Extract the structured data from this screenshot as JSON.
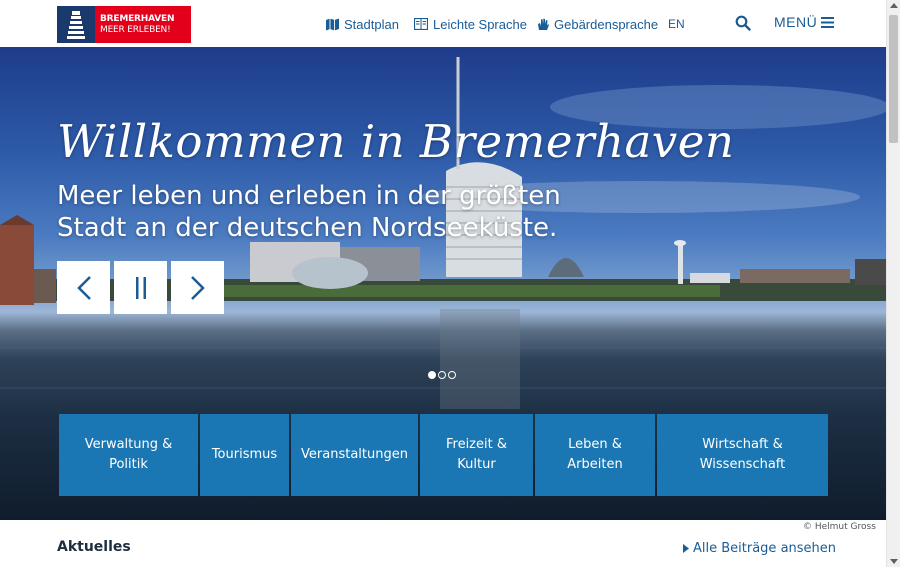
{
  "logo": {
    "line1": "BREMERHAVEN",
    "line2": "MEER ERLEBEN!",
    "mark_color": "#1a3a6e",
    "text_bg_color": "#e2001a"
  },
  "header": {
    "nav": [
      {
        "label": "Stadtplan",
        "icon": "map-icon"
      },
      {
        "label": "Leichte Sprache",
        "icon": "book-icon"
      },
      {
        "label": "Gebärdensprache",
        "icon": "hand-icon"
      },
      {
        "label": "EN",
        "icon": ""
      }
    ],
    "search_icon": "search-icon",
    "menu_label": "MENÜ",
    "menu_icon": "hamburger-icon",
    "link_color": "#1a5c96"
  },
  "hero": {
    "title": "Willkommen in Bremerhaven",
    "subtitle": "Meer leben und erleben in der größten Stadt an der deutschen Nordseeküste.",
    "controls": {
      "prev_icon": "chevron-left-icon",
      "pause_icon": "pause-icon",
      "next_icon": "chevron-right-icon"
    },
    "slides_total": 3,
    "slide_active": 1,
    "credit": "© Helmut Gross"
  },
  "tiles": [
    {
      "line1": "Verwaltung &",
      "line2": "Politik"
    },
    {
      "line1": "Tourismus",
      "line2": ""
    },
    {
      "line1": "Veranstaltungen",
      "line2": ""
    },
    {
      "line1": "Freizeit &",
      "line2": "Kultur"
    },
    {
      "line1": "Leben &",
      "line2": "Arbeiten"
    },
    {
      "line1": "Wirtschaft &",
      "line2": "Wissenschaft"
    }
  ],
  "tile_color": "#1b77b3",
  "news": {
    "title": "Aktuelles",
    "all_link": "Alle Beiträge ansehen"
  }
}
